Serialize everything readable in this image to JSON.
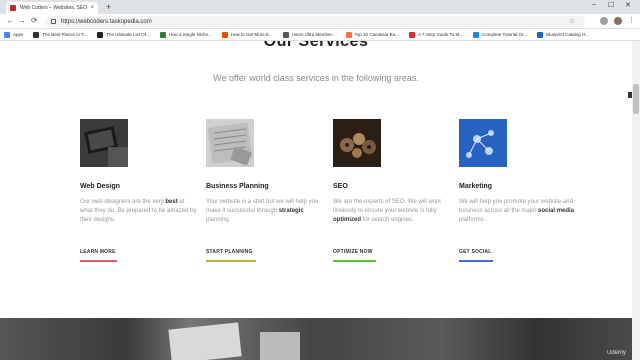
{
  "browser": {
    "tab_title": "Web Coders – Websites, SEO, Tr...",
    "tab_close": "×",
    "new_tab": "+",
    "url": "https://webcoders.taskopedia.com",
    "back": "←",
    "forward": "→",
    "reload": "⟳",
    "minimize": "–",
    "maximize": "☐",
    "close": "✕",
    "star": "☆",
    "bookmarks": [
      {
        "label": "Apps",
        "color": "#4285f4"
      },
      {
        "label": "The Best Places to T...",
        "color": "#333333"
      },
      {
        "label": "The Ultimate List Of...",
        "color": "#222222"
      },
      {
        "label": "How a Single Niche...",
        "color": "#2e7d32"
      },
      {
        "label": "How to Get More E...",
        "color": "#e65100"
      },
      {
        "label": "Users Ultra Member...",
        "color": "#555555"
      },
      {
        "label": "Top 10 Camtasia Bu...",
        "color": "#ff7043"
      },
      {
        "label": "A 7-Step Guide To M...",
        "color": "#d32f2f"
      },
      {
        "label": "Complete Tutorial Or...",
        "color": "#1e88e5"
      },
      {
        "label": "Blueprint Catalog H...",
        "color": "#1565c0"
      }
    ]
  },
  "section": {
    "heading": "Our Services",
    "subheading": "We offer world class services in the following areas."
  },
  "services": [
    {
      "title": "Web Design",
      "desc_1": "Our web designers are the very ",
      "desc_bold": "best",
      "desc_2": " at what they do. Be prepared to be amazed by their designs.",
      "link": "LEARN MORE",
      "line_color": "#e05a74"
    },
    {
      "title": "Business Planning",
      "desc_1": "Your website is a start but we will help you make it successful through ",
      "desc_bold": "strategic",
      "desc_2": " planning.",
      "link": "START PLANNING",
      "line_color": "#b9b13b"
    },
    {
      "title": "SEO",
      "desc_1": "We are the experts of SEO. We will work tirelessly to ensure your website is fully ",
      "desc_bold": "optimized",
      "desc_2": " for search engines.",
      "link": "OPTIMIZE NOW",
      "line_color": "#5bc236"
    },
    {
      "title": "Marketing",
      "desc_1": "We will help you promote your website and business across all the major ",
      "desc_bold": "social media",
      "desc_2": " platforms.",
      "link": "GET SOCIAL",
      "line_color": "#3f6fe0"
    }
  ],
  "watermark": "Udemy"
}
